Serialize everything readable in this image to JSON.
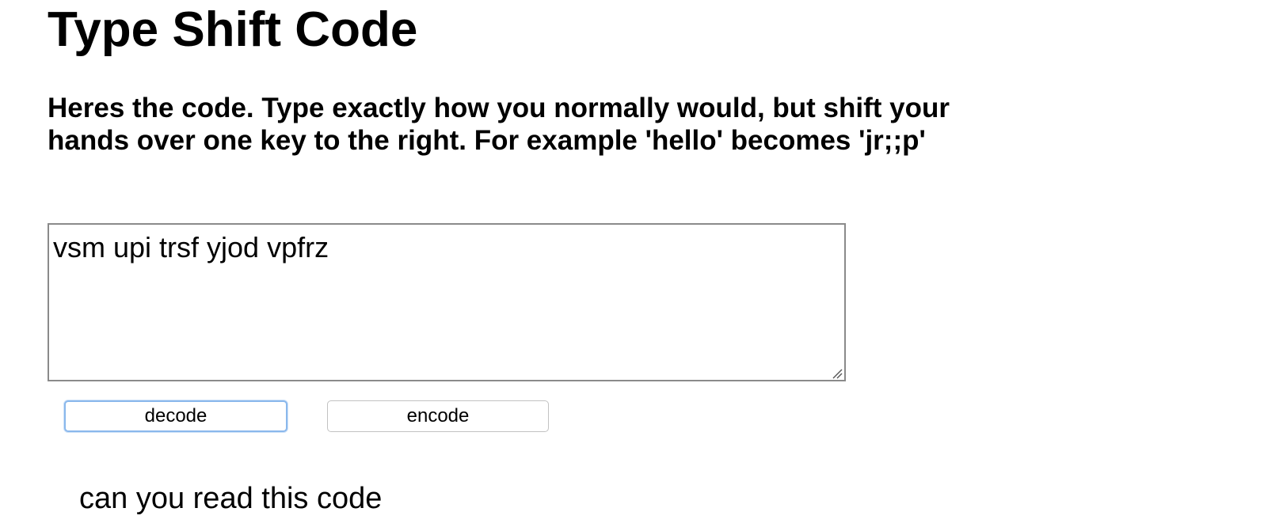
{
  "page": {
    "title": "Type Shift Code",
    "instructions": "Heres the code. Type exactly how you normally would, but shift your hands over one key to the right. For example 'hello' becomes 'jr;;p'"
  },
  "editor": {
    "value": "vsm upi trsf yjod vpfrz"
  },
  "buttons": {
    "decode_label": "decode",
    "encode_label": "encode"
  },
  "result": {
    "text": "can you read this code"
  },
  "colors": {
    "focus_ring": "#8ab8ec",
    "textarea_border": "#8a8a8a",
    "button_border": "#c2c2c2"
  },
  "icons": {
    "resize_grip": "resize-grip-icon"
  }
}
